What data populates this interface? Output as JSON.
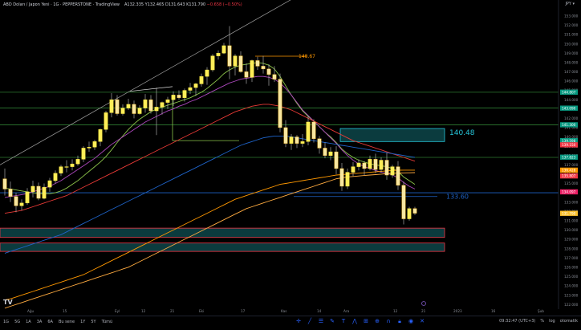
{
  "header": {
    "title": "ABD Doları / Japon Yeni · 1G · PEPPERSTONE · TradingView",
    "ohlc_label": "A132.335 Y132.465 D131.643 K131.790",
    "change": "−0.658 (−0.50%)"
  },
  "axis_currency": "JPY ▾",
  "price_axis": {
    "ticks": [
      "153.000",
      "152.000",
      "151.000",
      "150.000",
      "149.000",
      "148.000",
      "147.000",
      "146.000",
      "145.000",
      "144.000",
      "143.000",
      "142.000",
      "141.000",
      "140.000",
      "139.000",
      "138.000",
      "137.000",
      "136.000",
      "135.000",
      "134.000",
      "133.000",
      "132.000",
      "131.000",
      "130.000",
      "129.000",
      "128.000",
      "127.000",
      "126.000",
      "125.000",
      "124.000",
      "123.000",
      "122.000"
    ],
    "badges": [
      {
        "value": "144.807",
        "color": "#089981"
      },
      {
        "value": "143.090",
        "color": "#089981"
      },
      {
        "value": "141.300",
        "color": "#089981"
      },
      {
        "value": "139.598",
        "color": "#089981"
      },
      {
        "value": "139.150",
        "color": "#f23645"
      },
      {
        "value": "137.823",
        "color": "#089981"
      },
      {
        "value": "136.428",
        "color": "#ff9800"
      },
      {
        "value": "135.807",
        "color": "#f23645"
      },
      {
        "value": "134.097",
        "color": "#e91e63"
      },
      {
        "value": "131.790",
        "color": "#fbc02d"
      }
    ]
  },
  "time_axis": {
    "labels": [
      "Ağu",
      "15",
      "Eyl",
      "12",
      "21",
      "Eki",
      "17",
      "Kas",
      "14",
      "Ara",
      "12",
      "21",
      "2023",
      "16",
      "Şub"
    ]
  },
  "annotations": {
    "level_high": "148.67",
    "level_mid": "140.48",
    "level_low": "133.60"
  },
  "bottom_bar": {
    "intervals": [
      "1G",
      "5G",
      "1A",
      "3A",
      "6A",
      "Bu sene",
      "1Y",
      "5Y",
      "Tümü"
    ],
    "clock": "09:32:47 (UTC+3)",
    "percent": "%",
    "log": "log",
    "auto": "otomatik"
  },
  "chart_data": {
    "type": "candlestick",
    "symbol": "USDJPY",
    "ylim": [
      121.5,
      153.5
    ],
    "candles": [
      [
        135.5,
        136.6,
        133.7,
        134.4
      ],
      [
        134.4,
        135.2,
        133.0,
        133.6
      ],
      [
        133.6,
        134.0,
        131.9,
        132.6
      ],
      [
        132.6,
        133.3,
        132.1,
        132.9
      ],
      [
        132.9,
        134.5,
        132.7,
        134.1
      ],
      [
        134.1,
        135.3,
        133.5,
        134.7
      ],
      [
        134.7,
        135.1,
        133.2,
        133.4
      ],
      [
        133.4,
        135.0,
        133.3,
        134.6
      ],
      [
        134.6,
        135.6,
        134.1,
        135.3
      ],
      [
        135.3,
        136.4,
        135.0,
        136.1
      ],
      [
        136.1,
        137.0,
        135.8,
        136.8
      ],
      [
        136.8,
        137.5,
        136.2,
        136.8
      ],
      [
        136.8,
        137.6,
        136.4,
        137.1
      ],
      [
        137.1,
        138.0,
        136.9,
        137.6
      ],
      [
        137.6,
        139.0,
        137.3,
        138.8
      ],
      [
        138.8,
        139.5,
        138.4,
        138.9
      ],
      [
        138.9,
        139.7,
        138.6,
        139.5
      ],
      [
        139.5,
        140.9,
        139.0,
        140.8
      ],
      [
        140.8,
        142.8,
        140.5,
        142.6
      ],
      [
        142.6,
        144.7,
        142.1,
        144.0
      ],
      [
        144.0,
        144.5,
        142.3,
        142.5
      ],
      [
        142.5,
        143.5,
        142.3,
        143.1
      ],
      [
        143.1,
        144.1,
        142.9,
        143.5
      ],
      [
        143.5,
        143.9,
        142.0,
        142.5
      ],
      [
        142.5,
        143.4,
        142.4,
        143.1
      ],
      [
        143.1,
        144.6,
        142.6,
        144.0
      ],
      [
        144.0,
        144.5,
        142.5,
        142.8
      ],
      [
        142.8,
        145.3,
        140.2,
        143.2
      ],
      [
        143.2,
        143.8,
        142.4,
        143.7
      ],
      [
        143.7,
        144.3,
        143.0,
        144.0
      ],
      [
        144.0,
        144.9,
        143.3,
        144.5
      ],
      [
        144.5,
        145.0,
        144.0,
        144.2
      ],
      [
        144.2,
        145.2,
        143.8,
        145.0
      ],
      [
        145.0,
        145.8,
        144.6,
        145.3
      ],
      [
        145.3,
        145.8,
        144.4,
        145.7
      ],
      [
        145.7,
        146.8,
        145.4,
        146.5
      ],
      [
        146.5,
        147.5,
        145.6,
        147.2
      ],
      [
        147.2,
        148.9,
        147.0,
        148.7
      ],
      [
        148.7,
        149.3,
        148.3,
        149.0
      ],
      [
        149.0,
        150.1,
        148.9,
        149.8
      ],
      [
        149.8,
        151.9,
        146.2,
        147.6
      ],
      [
        147.6,
        148.9,
        146.6,
        148.7
      ],
      [
        148.7,
        149.2,
        146.9,
        147.0
      ],
      [
        147.0,
        147.9,
        145.7,
        146.4
      ],
      [
        146.4,
        148.3,
        145.9,
        148.2
      ],
      [
        148.2,
        148.6,
        147.2,
        147.6
      ],
      [
        147.6,
        148.7,
        146.8,
        147.3
      ],
      [
        147.3,
        147.8,
        145.5,
        146.7
      ],
      [
        146.7,
        147.6,
        145.9,
        146.2
      ],
      [
        146.2,
        146.8,
        140.5,
        141.0
      ],
      [
        141.0,
        141.8,
        138.9,
        139.3
      ],
      [
        139.3,
        140.3,
        138.6,
        140.0
      ],
      [
        140.0,
        140.2,
        138.8,
        139.3
      ],
      [
        139.3,
        140.3,
        138.9,
        139.5
      ],
      [
        139.5,
        142.2,
        139.1,
        141.6
      ],
      [
        141.6,
        141.9,
        139.4,
        139.8
      ],
      [
        139.8,
        140.1,
        138.2,
        138.8
      ],
      [
        138.8,
        139.4,
        137.7,
        138.0
      ],
      [
        138.0,
        138.9,
        137.5,
        138.4
      ],
      [
        138.4,
        139.0,
        136.0,
        136.6
      ],
      [
        136.6,
        137.2,
        134.2,
        134.7
      ],
      [
        134.7,
        136.6,
        134.4,
        136.2
      ],
      [
        136.2,
        137.3,
        135.8,
        136.8
      ],
      [
        136.8,
        137.6,
        136.4,
        137.2
      ],
      [
        137.2,
        137.4,
        135.9,
        136.6
      ],
      [
        136.6,
        138.0,
        136.4,
        137.6
      ],
      [
        137.6,
        138.2,
        136.1,
        136.5
      ],
      [
        136.5,
        137.8,
        136.2,
        137.5
      ],
      [
        137.5,
        138.3,
        135.4,
        135.9
      ],
      [
        135.9,
        137.0,
        135.6,
        136.8
      ],
      [
        136.8,
        137.4,
        134.3,
        134.8
      ],
      [
        134.8,
        135.2,
        130.6,
        131.2
      ],
      [
        131.2,
        132.5,
        131.0,
        132.3
      ],
      [
        132.3,
        132.5,
        131.6,
        131.8
      ]
    ],
    "moving_averages": [
      {
        "name": "",
        "color": "#8bc34a",
        "values": [
          134.5,
          134.4,
          134.3,
          134.2,
          134.1,
          134.0,
          133.9,
          133.9,
          133.9,
          134.0,
          134.2,
          134.5,
          134.9,
          135.3,
          135.8,
          136.3,
          136.8,
          137.3,
          137.9,
          138.6,
          139.4,
          140.1,
          140.8,
          141.4,
          141.9,
          142.3,
          142.7,
          143.0,
          143.2,
          143.4,
          143.6,
          143.8,
          144.0,
          144.2,
          144.5,
          144.8,
          145.2,
          145.7,
          146.2,
          146.8,
          147.2,
          147.5,
          147.7,
          147.8,
          147.9,
          148.0,
          147.9,
          147.7,
          147.3,
          146.5,
          145.5,
          144.5,
          143.6,
          142.8,
          142.2,
          141.7,
          141.1,
          140.5,
          140.0,
          139.4,
          138.7,
          138.2,
          137.8,
          137.5,
          137.3,
          137.1,
          137.0,
          136.9,
          136.8,
          136.6,
          136.3,
          135.7,
          135.3,
          134.9
        ]
      },
      {
        "name": "",
        "color": "#ab47bc",
        "values": [
          133.5,
          133.6,
          133.7,
          133.8,
          133.9,
          134.1,
          134.3,
          134.5,
          134.7,
          135.0,
          135.3,
          135.7,
          136.1,
          136.5,
          136.9,
          137.3,
          137.7,
          138.2,
          138.7,
          139.2,
          139.6,
          140.0,
          140.4,
          140.8,
          141.2,
          141.6,
          141.9,
          142.2,
          142.5,
          142.8,
          143.0,
          143.3,
          143.5,
          143.8,
          144.0,
          144.3,
          144.6,
          144.9,
          145.2,
          145.5,
          145.8,
          146.0,
          146.2,
          146.3,
          146.4,
          146.5,
          146.5,
          146.4,
          146.2,
          145.8,
          145.2,
          144.5,
          143.7,
          142.9,
          142.3,
          141.7,
          141.1,
          140.5,
          139.9,
          139.3,
          138.6,
          138.0,
          137.5,
          137.1,
          136.8,
          136.6,
          136.4,
          136.2,
          136.1,
          135.9,
          135.6,
          135.1,
          134.7,
          134.4
        ]
      },
      {
        "name": "",
        "color": "#e53935",
        "values": [
          131.8,
          131.9,
          132.0,
          132.1,
          132.3,
          132.5,
          132.7,
          132.9,
          133.1,
          133.3,
          133.5,
          133.7,
          134.0,
          134.3,
          134.6,
          134.9,
          135.2,
          135.5,
          135.8,
          136.1,
          136.4,
          136.7,
          137.0,
          137.3,
          137.6,
          137.9,
          138.2,
          138.5,
          138.8,
          139.1,
          139.4,
          139.7,
          140.0,
          140.3,
          140.6,
          140.9,
          141.2,
          141.5,
          141.8,
          142.1,
          142.4,
          142.7,
          142.9,
          143.1,
          143.3,
          143.4,
          143.5,
          143.5,
          143.4,
          143.3,
          143.1,
          142.9,
          142.6,
          142.3,
          142.0,
          141.7,
          141.4,
          141.1,
          140.8,
          140.5,
          140.2,
          139.9,
          139.6,
          139.4,
          139.2,
          139.0,
          138.8,
          138.6,
          138.4,
          138.2,
          138.0,
          137.8,
          137.6,
          137.4
        ]
      },
      {
        "name": "",
        "color": "#1e63c8",
        "values": [
          127.5,
          127.7,
          127.9,
          128.1,
          128.3,
          128.5,
          128.7,
          128.9,
          129.1,
          129.3,
          129.5,
          129.8,
          130.1,
          130.4,
          130.7,
          131.0,
          131.3,
          131.6,
          131.9,
          132.2,
          132.5,
          132.8,
          133.1,
          133.4,
          133.7,
          134.0,
          134.3,
          134.6,
          134.9,
          135.2,
          135.5,
          135.8,
          136.1,
          136.4,
          136.7,
          137.0,
          137.3,
          137.6,
          137.9,
          138.2,
          138.5,
          138.8,
          139.1,
          139.3,
          139.5,
          139.7,
          139.9,
          140.0,
          140.1,
          140.1,
          140.1,
          140.0,
          139.9,
          139.8,
          139.7,
          139.6,
          139.5,
          139.4,
          139.3,
          139.2,
          139.1,
          139.0,
          138.9,
          138.8,
          138.7,
          138.6,
          138.5,
          138.4,
          138.3,
          138.2,
          138.1,
          138.0,
          137.9,
          137.8
        ]
      },
      {
        "name": "",
        "color": "#ff9800",
        "values": [
          122.5,
          122.6,
          122.8,
          123.0,
          123.2,
          123.4,
          123.6,
          123.8,
          124.0,
          124.2,
          124.4,
          124.6,
          124.8,
          125.0,
          125.2,
          125.5,
          125.8,
          126.1,
          126.4,
          126.7,
          127.0,
          127.3,
          127.6,
          127.9,
          128.2,
          128.5,
          128.8,
          129.1,
          129.4,
          129.7,
          130.0,
          130.3,
          130.6,
          130.9,
          131.2,
          131.5,
          131.8,
          132.1,
          132.4,
          132.7,
          133.0,
          133.3,
          133.5,
          133.7,
          133.9,
          134.1,
          134.3,
          134.5,
          134.7,
          134.9,
          135.0,
          135.1,
          135.2,
          135.3,
          135.4,
          135.5,
          135.6,
          135.7,
          135.8,
          135.9,
          135.95,
          136.0,
          136.05,
          136.1,
          136.15,
          136.2,
          136.25,
          136.3,
          136.35,
          136.4,
          136.42,
          136.43,
          136.43,
          136.43
        ]
      },
      {
        "name": "",
        "color": "#ffab40",
        "values": [
          121.6,
          121.8,
          122.0,
          122.2,
          122.4,
          122.6,
          122.8,
          123.0,
          123.2,
          123.4,
          123.6,
          123.8,
          124.0,
          124.2,
          124.4,
          124.6,
          124.8,
          125.0,
          125.2,
          125.4,
          125.6,
          125.8,
          126.0,
          126.3,
          126.6,
          126.9,
          127.2,
          127.5,
          127.8,
          128.1,
          128.4,
          128.7,
          129.0,
          129.3,
          129.6,
          129.9,
          130.2,
          130.5,
          130.8,
          131.1,
          131.4,
          131.7,
          132.0,
          132.3,
          132.5,
          132.7,
          132.9,
          133.1,
          133.3,
          133.5,
          133.7,
          133.9,
          134.1,
          134.3,
          134.5,
          134.7,
          134.9,
          135.1,
          135.3,
          135.5,
          135.6,
          135.7,
          135.75,
          135.8,
          135.85,
          135.9,
          135.95,
          136.0,
          136.05,
          136.1,
          136.12,
          136.14,
          136.15,
          136.16
        ]
      }
    ]
  }
}
